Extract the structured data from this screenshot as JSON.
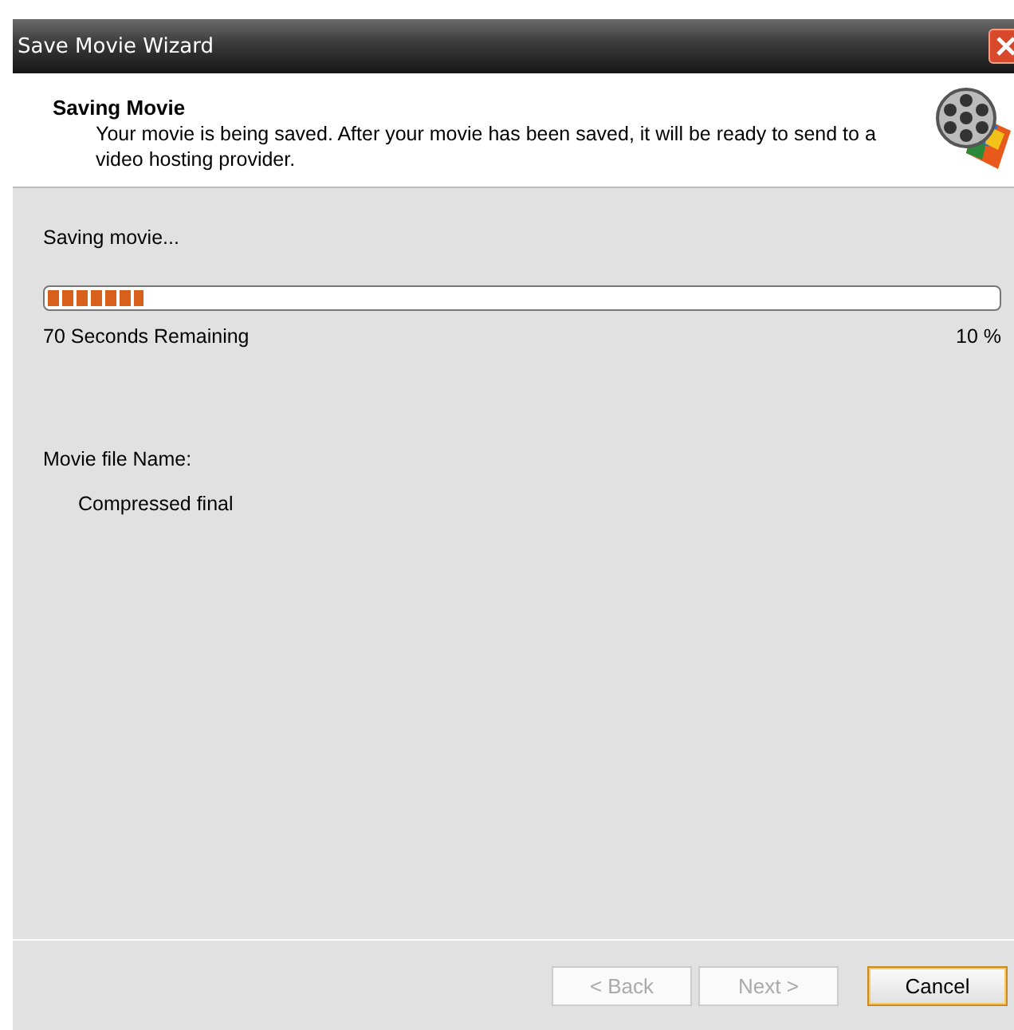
{
  "window": {
    "title": "Save Movie Wizard"
  },
  "header": {
    "title": "Saving Movie",
    "description": "Your movie is being saved. After your movie has been saved, it will be ready to send to a video hosting provider."
  },
  "status": "Saving movie...",
  "progress": {
    "level": 0.1,
    "remaining": "70 Seconds Remaining",
    "percent": "10 %"
  },
  "file": {
    "label": "Movie file Name:",
    "name": "Compressed final"
  },
  "buttons": [
    {
      "label": "< Back",
      "disabled": true,
      "default": false
    },
    {
      "label": "Next >",
      "disabled": true,
      "default": false
    },
    {
      "label": "Cancel",
      "disabled": false,
      "default": true
    }
  ]
}
